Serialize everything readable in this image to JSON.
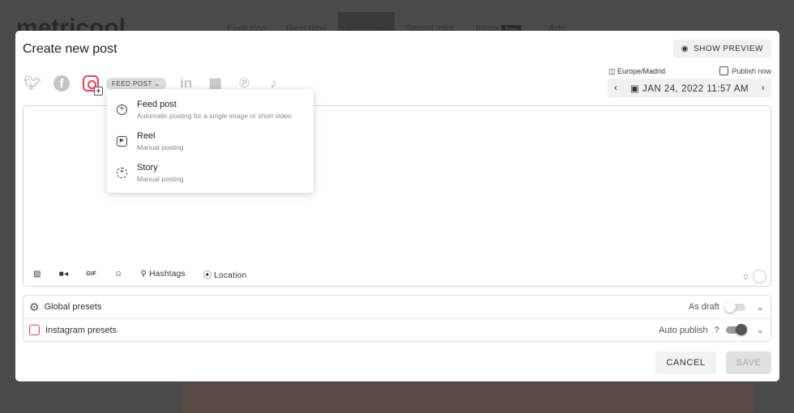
{
  "background": {
    "logo": "metricool",
    "nav": [
      "Evolution",
      "Real time",
      "Planning",
      "SmartLinks",
      "Inbox",
      "Ads"
    ],
    "new_badge": "New"
  },
  "modal": {
    "title": "Create new post",
    "show_preview": "SHOW PREVIEW",
    "timezone": "Europe/Madrid",
    "publish_now": "Publish now",
    "date": "JAN 24, 2022 11:57 AM",
    "networks": [
      "twitter",
      "facebook",
      "instagram",
      "linkedin",
      "google-business",
      "pinterest",
      "tiktok"
    ],
    "post_type": "FEED POST",
    "menu": [
      {
        "title": "Feed post",
        "subtitle": "Automatic posting for a single image or short video"
      },
      {
        "title": "Reel",
        "subtitle": "Manual posting"
      },
      {
        "title": "Story",
        "subtitle": "Manual posting"
      }
    ],
    "tools": {
      "hashtags": "Hashtags",
      "location": "Location",
      "gif": "GIF"
    },
    "char_count": "0",
    "presets": [
      {
        "label": "Global presets",
        "toggle_label": "As draft",
        "on": false
      },
      {
        "label": "Instagram presets",
        "toggle_label": "Auto publish",
        "help": "?",
        "on": true
      }
    ],
    "cancel": "CANCEL",
    "save": "SAVE"
  },
  "colors": {
    "instagram": "#e4405f"
  }
}
